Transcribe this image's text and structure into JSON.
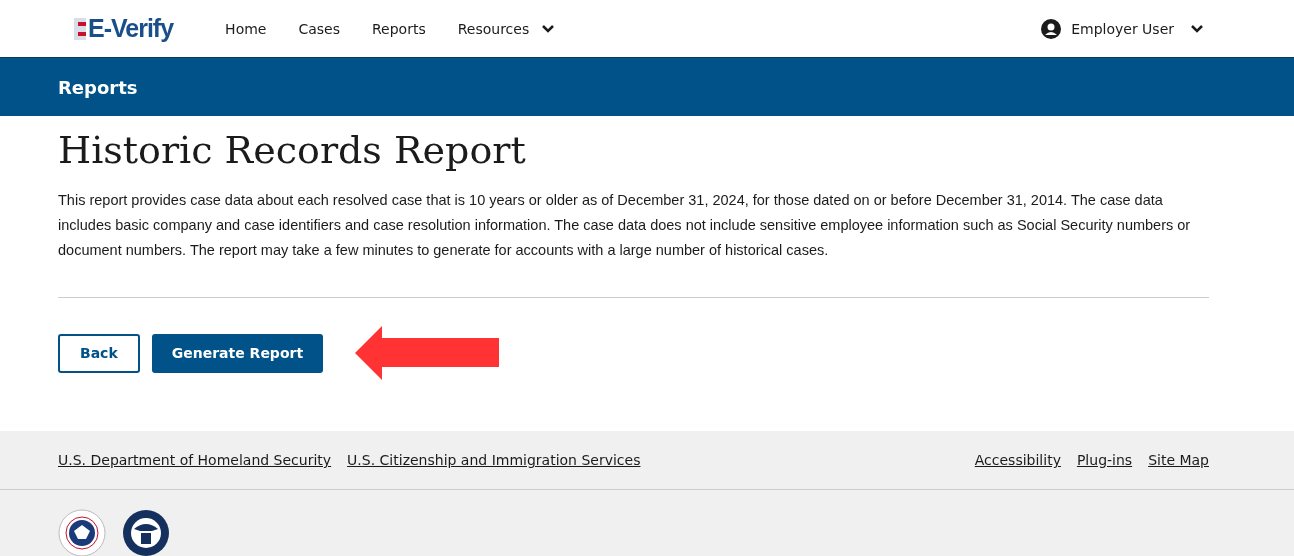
{
  "header": {
    "logo": "E-Verify",
    "nav": [
      {
        "label": "Home",
        "dropdown": false
      },
      {
        "label": "Cases",
        "dropdown": false
      },
      {
        "label": "Reports",
        "dropdown": false
      },
      {
        "label": "Resources",
        "dropdown": true
      }
    ],
    "user": "Employer User"
  },
  "banner": {
    "title": "Reports"
  },
  "page": {
    "title": "Historic Records Report",
    "description": "This report provides case data about each resolved case that is 10 years or older as of December 31, 2024, for those dated on or before December 31, 2014. The case data includes basic company and case identifiers and case resolution information. The case data does not include sensitive employee information such as Social Security numbers or document numbers. The report may take a few minutes to generate for accounts with a large number of historical cases.",
    "buttons": [
      {
        "label": "Back",
        "kind": "outline"
      },
      {
        "label": "Generate Report",
        "kind": "primary"
      }
    ],
    "annotation": {
      "kind": "arrow"
    }
  },
  "footer": {
    "links_left": [
      "U.S. Department of Homeland Security",
      "U.S. Citizenship and Immigration Services"
    ],
    "links_right": [
      "Accessibility",
      "Plug-ins",
      "Site Map"
    ]
  }
}
